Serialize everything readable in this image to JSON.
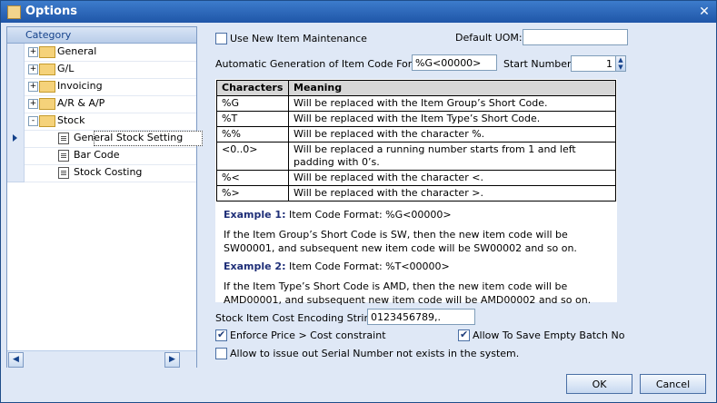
{
  "window": {
    "title": "Options"
  },
  "tree": {
    "header": "Category",
    "nodes": [
      {
        "label": "General",
        "expander": "+"
      },
      {
        "label": "G/L",
        "expander": "+"
      },
      {
        "label": "Invoicing",
        "expander": "+"
      },
      {
        "label": "A/R & A/P",
        "expander": "+"
      },
      {
        "label": "Stock",
        "expander": "-"
      },
      {
        "label": "General Stock Setting"
      },
      {
        "label": "Bar Code"
      },
      {
        "label": "Stock Costing"
      }
    ]
  },
  "settings": {
    "use_new_item_maintenance": "Use New Item Maintenance",
    "use_new_item_maintenance_checked": false,
    "default_uom_label": "Default UOM:",
    "default_uom_value": "",
    "auto_gen_label": "Automatic Generation of Item Code Forma",
    "auto_gen_value": "%G<00000>",
    "start_number_label": "Start Number:",
    "start_number_value": "1"
  },
  "info_table": {
    "headers": [
      "Characters",
      "Meaning"
    ],
    "rows": [
      [
        "%G",
        "Will be replaced with the Item Group’s Short Code."
      ],
      [
        "%T",
        "Will be replaced with the Item Type’s Short Code."
      ],
      [
        "%%",
        "Will be replaced with the character %."
      ],
      [
        "<0..0>",
        "Will be replaced a running number starts from 1 and left padding with 0’s."
      ],
      [
        "%<",
        "Will be replaced with the character <."
      ],
      [
        "%>",
        "Will be replaced with the character >."
      ]
    ]
  },
  "examples": [
    {
      "title": "Example 1:",
      "format": "Item Code Format: %G<00000>",
      "text": "If the Item Group’s Short Code is SW, then the new item code will be SW00001, and subsequent new item code will be SW00002 and so on."
    },
    {
      "title": "Example 2:",
      "format": "Item Code Format: %T<00000>",
      "text": "If the Item Type’s Short Code is AMD, then the new item code will be AMD00001, and subsequent new item code will be AMD00002 and so on."
    }
  ],
  "cost": {
    "encoding_label": "Stock Item Cost Encoding String:",
    "encoding_value": "0123456789,.",
    "enforce_price": "Enforce Price > Cost constraint",
    "enforce_price_checked": true,
    "allow_empty_batch": "Allow To Save Empty Batch No",
    "allow_empty_batch_checked": true,
    "allow_serial": "Allow to issue out Serial Number not exists in the system.",
    "allow_serial_checked": false
  },
  "buttons": {
    "ok": "OK",
    "cancel": "Cancel"
  }
}
